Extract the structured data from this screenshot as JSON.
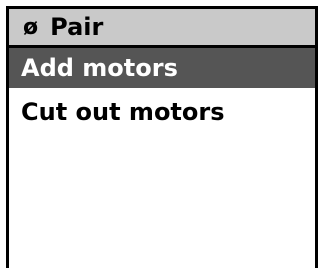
{
  "header": {
    "icon": "ø",
    "icon_name": "empty-set-icon",
    "title": "Pair"
  },
  "menu": {
    "items": [
      {
        "label": "Add motors",
        "selected": true
      },
      {
        "label": "Cut out motors",
        "selected": false
      }
    ]
  },
  "colors": {
    "header_background": "#c9c9c9",
    "selected_background": "#555555",
    "selected_text": "#ffffff",
    "text": "#000000",
    "border": "#000000"
  }
}
